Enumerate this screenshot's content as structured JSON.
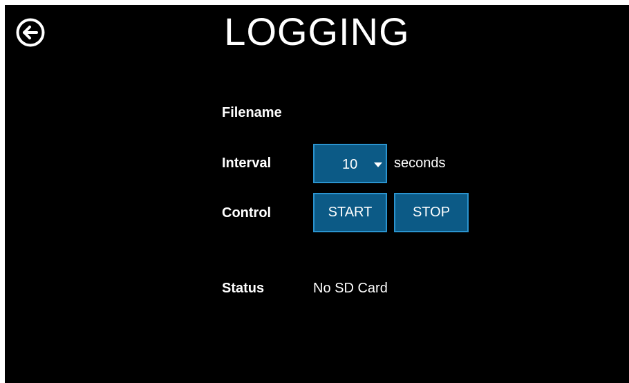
{
  "header": {
    "title": "LOGGING",
    "back_icon": "arrow-left-circle-icon"
  },
  "form": {
    "filename_label": "Filename",
    "interval_label": "Interval",
    "interval_value": "10",
    "interval_unit": "seconds",
    "control_label": "Control",
    "start_label": "START",
    "stop_label": "STOP",
    "status_label": "Status",
    "status_value": "No SD Card"
  },
  "colors": {
    "background": "#000000",
    "button_fill": "#0c5a86",
    "button_border": "#2b94cf",
    "text": "#ffffff"
  }
}
